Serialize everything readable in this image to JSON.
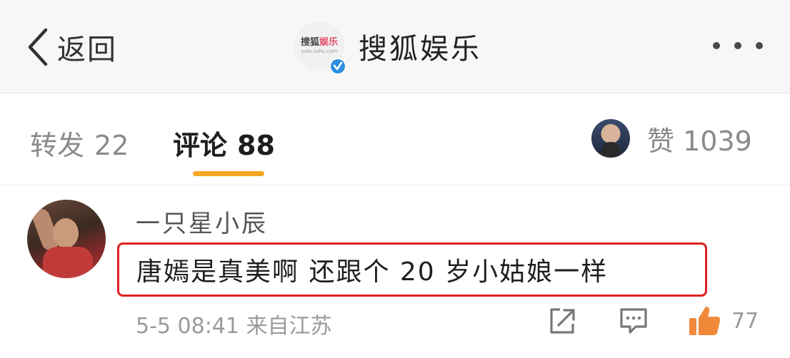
{
  "header": {
    "back_label": "返回",
    "account_name": "搜狐娱乐",
    "logo_text_1": "搜狐",
    "logo_text_2": "娱乐",
    "logo_sub": "yule.sohu.com",
    "more_icon": "more-dots-icon",
    "verified_icon": "verified-badge-icon"
  },
  "tabs": {
    "repost_label": "转发",
    "repost_count": "22",
    "comment_label": "评论",
    "comment_count": "88",
    "like_label": "赞",
    "like_count": "1039",
    "active_tab": "评论",
    "accent_color": "#f5a623"
  },
  "comment": {
    "username": "一只星小辰",
    "text": "唐嫣是真美啊  还跟个 20 岁小姑娘一样",
    "timestamp": "5-5 08:41",
    "source": "来自江苏",
    "like_count": "77",
    "highlight_color": "#e02020",
    "like_icon_color": "#f08a3a"
  }
}
